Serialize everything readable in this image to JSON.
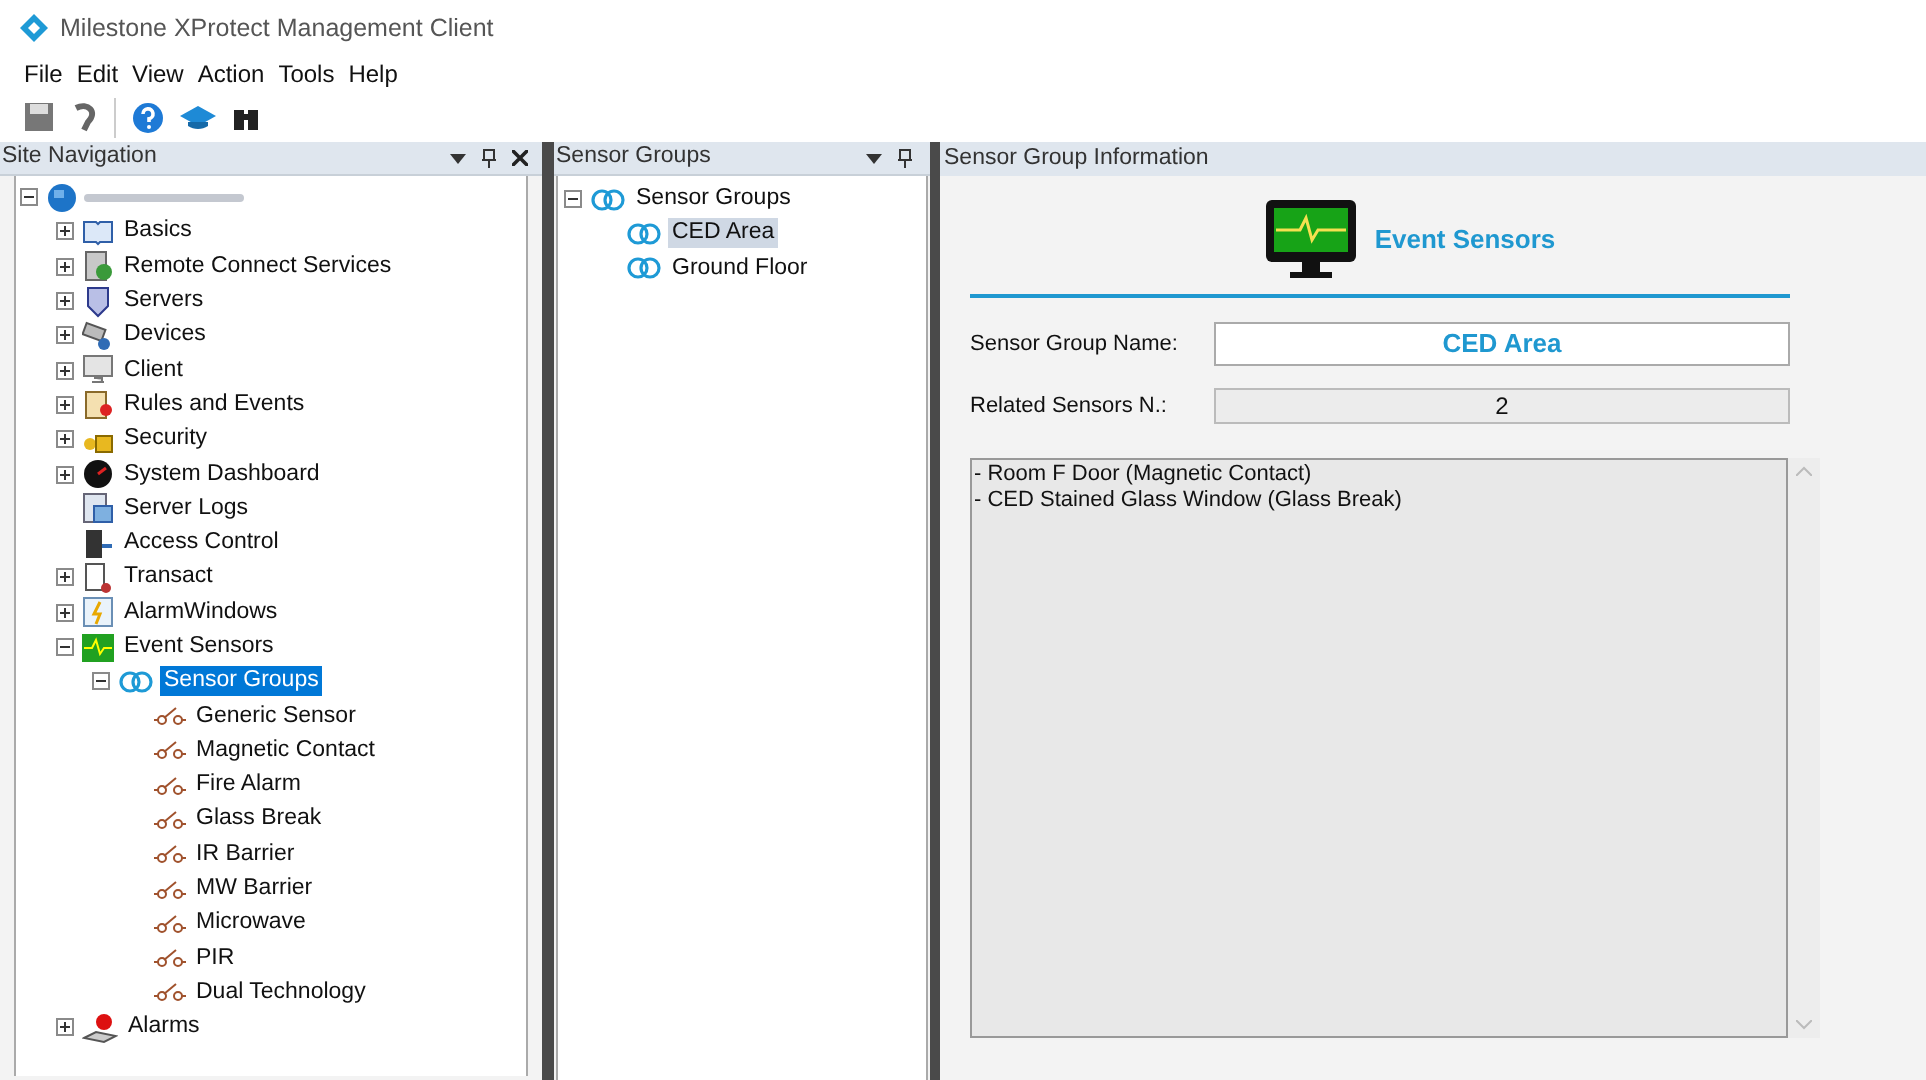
{
  "window": {
    "title": "Milestone XProtect Management Client"
  },
  "menu": [
    "File",
    "Edit",
    "View",
    "Action",
    "Tools",
    "Help"
  ],
  "site_navigation": {
    "title": "Site Navigation",
    "root": {
      "expanded": true,
      "children": [
        {
          "label": "Basics",
          "expanded": false,
          "selected": false
        },
        {
          "label": "Remote Connect Services",
          "expanded": false,
          "selected": false
        },
        {
          "label": "Servers",
          "expanded": false,
          "selected": false
        },
        {
          "label": "Devices",
          "expanded": false,
          "selected": false
        },
        {
          "label": "Client",
          "expanded": false,
          "selected": false
        },
        {
          "label": "Rules and Events",
          "expanded": false,
          "selected": false
        },
        {
          "label": "Security",
          "expanded": false,
          "selected": false
        },
        {
          "label": "System Dashboard",
          "expanded": false,
          "selected": false
        },
        {
          "label": "Server Logs",
          "selected": false
        },
        {
          "label": "Access Control",
          "selected": false
        },
        {
          "label": "Transact",
          "expanded": false,
          "selected": false
        },
        {
          "label": "AlarmWindows",
          "expanded": false,
          "selected": false
        },
        {
          "label": "Event Sensors",
          "expanded": true,
          "selected": false,
          "children": [
            {
              "label": "Sensor Groups",
              "expanded": true,
              "selected": true,
              "children": [
                {
                  "label": "Generic Sensor",
                  "selected": false
                },
                {
                  "label": "Magnetic Contact",
                  "selected": false
                },
                {
                  "label": "Fire Alarm",
                  "selected": false
                },
                {
                  "label": "Glass Break",
                  "selected": false
                },
                {
                  "label": "IR Barrier",
                  "selected": false
                },
                {
                  "label": "MW Barrier",
                  "selected": false
                },
                {
                  "label": "Microwave",
                  "selected": false
                },
                {
                  "label": "PIR",
                  "selected": false
                },
                {
                  "label": "Dual Technology",
                  "selected": false
                }
              ]
            }
          ]
        },
        {
          "label": "Alarms",
          "expanded": false,
          "selected": false
        }
      ]
    }
  },
  "sensor_groups": {
    "title": "Sensor Groups",
    "tree": [
      {
        "label": "Sensor Groups",
        "expanded": true,
        "selected": false,
        "children": [
          {
            "label": "CED Area",
            "selected": true
          },
          {
            "label": "Ground Floor",
            "selected": false
          }
        ]
      }
    ]
  },
  "info": {
    "title": "Sensor Group Information",
    "heading": "Event Sensors",
    "fields": [
      {
        "label": "Sensor Group Name:",
        "value": "CED Area",
        "kind": "editable"
      },
      {
        "label": "Related Sensors N.:",
        "value": "2",
        "kind": "readonly"
      }
    ],
    "sensors": [
      "- Room F Door (Magnetic Contact)",
      "- CED Stained Glass Window (Glass Break)"
    ]
  }
}
